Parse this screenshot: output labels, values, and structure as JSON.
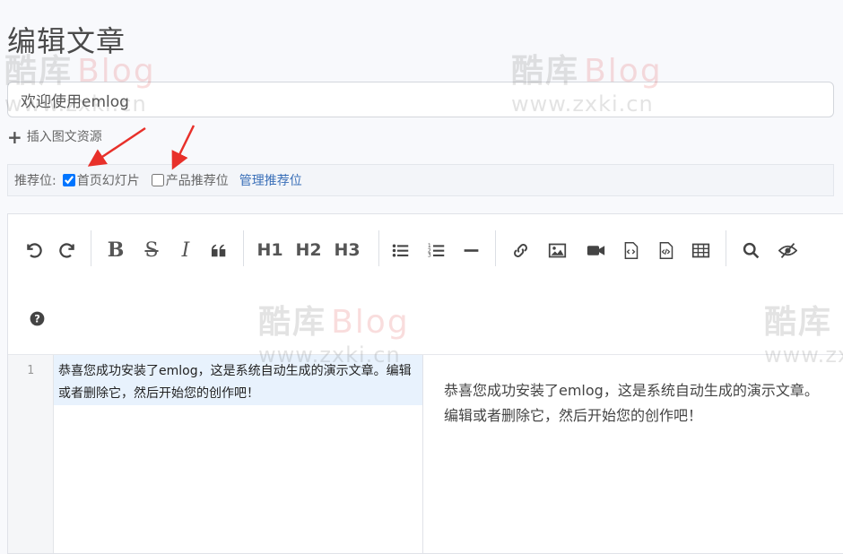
{
  "page": {
    "title": "编辑文章"
  },
  "post": {
    "title_value": "欢迎使用emlog",
    "insert_resource_label": "插入图文资源"
  },
  "recommend": {
    "label": "推荐位:",
    "options": [
      {
        "label": "首页幻灯片",
        "checked": true
      },
      {
        "label": "产品推荐位",
        "checked": false
      }
    ],
    "manage_label": "管理推荐位"
  },
  "toolbar": {
    "icons": [
      "undo-icon",
      "redo-icon",
      "bold-icon",
      "strikethrough-icon",
      "italic-icon",
      "quote-icon",
      "h1",
      "h2",
      "h3",
      "bullet-list-icon",
      "numbered-list-icon",
      "horizontal-rule-icon",
      "link-icon",
      "image-icon",
      "video-icon",
      "code-icon",
      "code-block-icon",
      "table-icon",
      "search-icon",
      "preview-toggle-icon",
      "help-icon"
    ],
    "h1": "H1",
    "h2": "H2",
    "h3": "H3",
    "bold": "B",
    "strike": "S",
    "italic": "I"
  },
  "editor": {
    "line_number": "1",
    "content": "恭喜您成功安装了emlog，这是系统自动生成的演示文章。编辑或者删除它，然后开始您的创作吧！",
    "preview": "恭喜您成功安装了emlog，这是系统自动生成的演示文章。编辑或者删除它，然后开始您的创作吧！"
  },
  "watermark": {
    "brand": "酷库",
    "blog": "Blog",
    "url": "www.zxki.cn"
  },
  "colors": {
    "accent": "#3a6fb8",
    "arrow": "#e8302a",
    "page_bg": "#f8f9fc",
    "line_highlight": "#e8f2fd"
  }
}
